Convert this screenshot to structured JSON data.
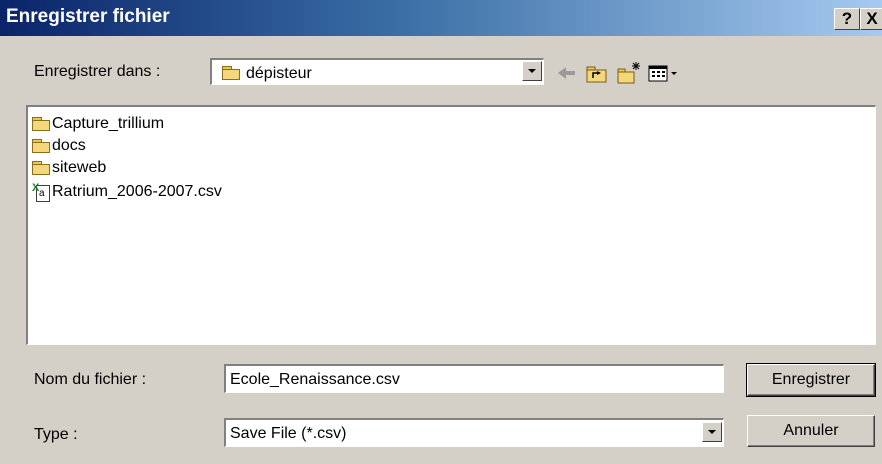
{
  "window": {
    "title": "Enregistrer fichier",
    "help_label": "?",
    "close_label": "X"
  },
  "save_in": {
    "label": "Enregistrer dans :",
    "value": "dépisteur",
    "icon": "folder-icon"
  },
  "toolbar": {
    "icons": [
      "back-arrow-icon",
      "up-folder-icon",
      "new-folder-icon",
      "view-menu-icon"
    ]
  },
  "files": [
    {
      "name": "Capture_trillium",
      "icon": "folder-icon"
    },
    {
      "name": "docs",
      "icon": "folder-icon"
    },
    {
      "name": "siteweb",
      "icon": "folder-icon"
    },
    {
      "name": "Ratrium_2006-2007.csv",
      "icon": "csv-file-icon"
    }
  ],
  "filename": {
    "label": "Nom du fichier :",
    "value": "Ecole_Renaissance.csv"
  },
  "filetype": {
    "label": "Type :",
    "value": "Save File (*.csv)"
  },
  "buttons": {
    "save": "Enregistrer",
    "cancel": "Annuler"
  },
  "colors": {
    "title_gradient_start": "#0a246a",
    "title_gradient_end": "#a6caf0",
    "dialog_bg": "#d4d0c8"
  }
}
